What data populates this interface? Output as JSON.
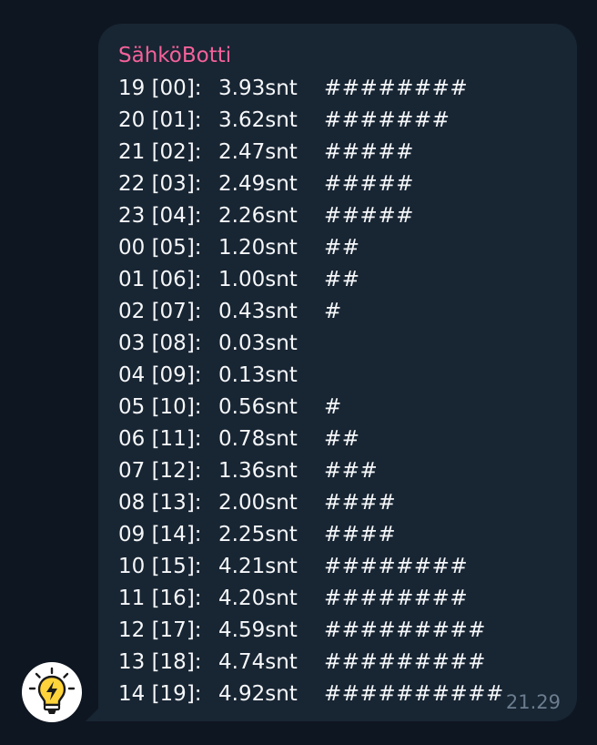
{
  "message": {
    "sender": "SähköBotti",
    "time": "21.29",
    "rows": [
      {
        "hour": "19 [00]:",
        "price": "3.93snt",
        "bar": "########"
      },
      {
        "hour": "20 [01]:",
        "price": "3.62snt",
        "bar": "#######"
      },
      {
        "hour": "21 [02]:",
        "price": "2.47snt",
        "bar": "#####"
      },
      {
        "hour": "22 [03]:",
        "price": "2.49snt",
        "bar": "#####"
      },
      {
        "hour": "23 [04]:",
        "price": "2.26snt",
        "bar": "#####"
      },
      {
        "hour": "00 [05]:",
        "price": "1.20snt",
        "bar": "##"
      },
      {
        "hour": "01 [06]:",
        "price": "1.00snt",
        "bar": "##"
      },
      {
        "hour": "02 [07]:",
        "price": "0.43snt",
        "bar": "#"
      },
      {
        "hour": "03 [08]:",
        "price": "0.03snt",
        "bar": ""
      },
      {
        "hour": "04 [09]:",
        "price": "0.13snt",
        "bar": ""
      },
      {
        "hour": "05 [10]:",
        "price": "0.56snt",
        "bar": "#"
      },
      {
        "hour": "06 [11]:",
        "price": "0.78snt",
        "bar": "##"
      },
      {
        "hour": "07 [12]:",
        "price": "1.36snt",
        "bar": "###"
      },
      {
        "hour": "08 [13]:",
        "price": "2.00snt",
        "bar": "####"
      },
      {
        "hour": "09 [14]:",
        "price": "2.25snt",
        "bar": "####"
      },
      {
        "hour": "10 [15]:",
        "price": "4.21snt",
        "bar": "########"
      },
      {
        "hour": "11 [16]:",
        "price": "4.20snt",
        "bar": "########"
      },
      {
        "hour": "12 [17]:",
        "price": "4.59snt",
        "bar": "#########"
      },
      {
        "hour": "13 [18]:",
        "price": "4.74snt",
        "bar": "#########"
      },
      {
        "hour": "14 [19]:",
        "price": "4.92snt",
        "bar": "##########"
      }
    ]
  },
  "avatar": {
    "icon": "lightbulb-lightning-icon",
    "bulb_color": "#ffd43b"
  },
  "colors": {
    "background": "#0e1621",
    "bubble": "#182533",
    "sender": "#f4629a",
    "text": "#f5f7f9",
    "time": "#6b7d8e"
  }
}
